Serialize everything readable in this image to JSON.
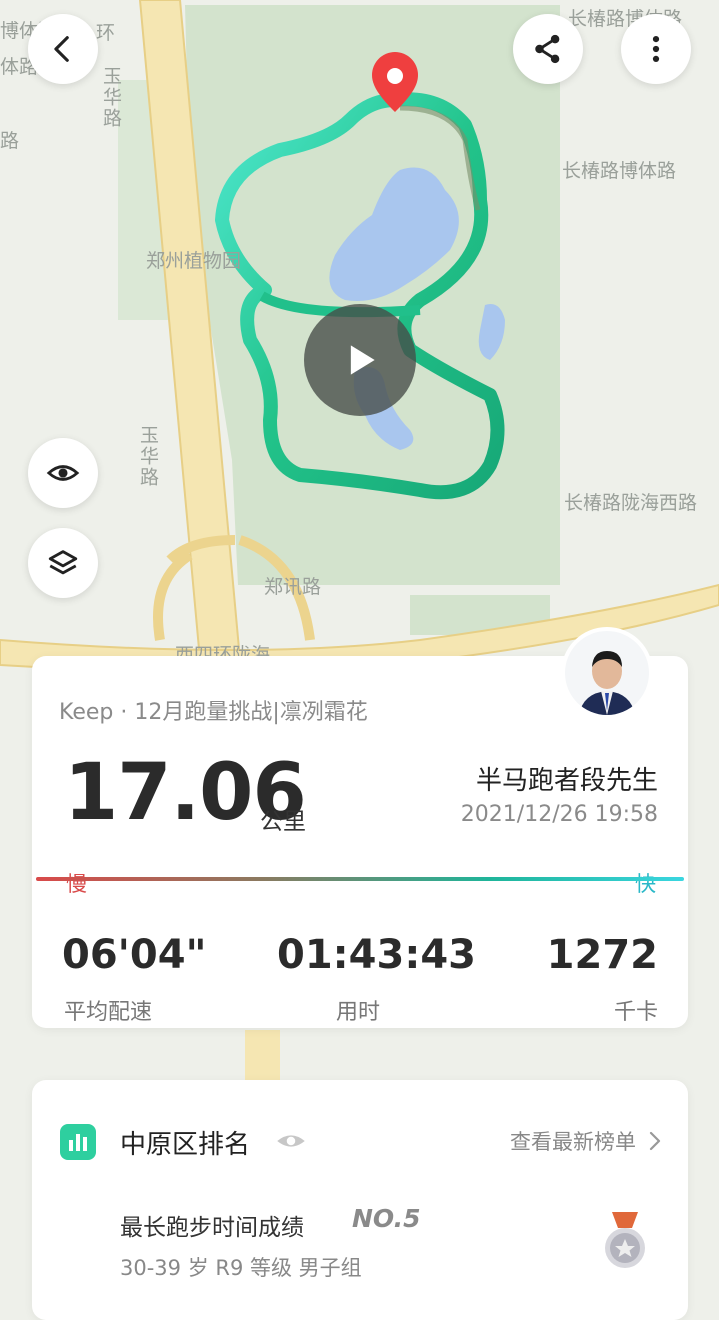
{
  "map": {
    "labels": {
      "top_left_1": "博体路",
      "top_left_2": "环",
      "left_1": "体路",
      "left_2": "路",
      "road_v1": "玉华路",
      "road_v2": "玉华路",
      "park": "郑州植物园",
      "right_top": "长椿路博体路",
      "right_mid": "长椿路博体路",
      "right_low": "长椿路陇海西路",
      "bottom_mid": "郑讯路",
      "bottom_left": "西四环陇海"
    },
    "route_color_start": "#2fe0b0",
    "route_color_end": "#1fb57a"
  },
  "stats": {
    "source": "Keep · 12月跑量挑战|凛冽霜花",
    "distance": "17.06",
    "distance_unit": "公里",
    "user_name": "半马跑者段先生",
    "datetime": "2021/12/26 19:58",
    "pace_slow": "慢",
    "pace_fast": "快",
    "avg_pace_value": "06'04\"",
    "avg_pace_label": "平均配速",
    "duration_value": "01:43:43",
    "duration_label": "用时",
    "calories_value": "1272",
    "calories_label": "千卡",
    "gradient_colors": [
      "#d94a4a",
      "#7a8a6a",
      "#1fb5a0",
      "#3ad6e0"
    ]
  },
  "rank": {
    "title": "中原区排名",
    "view_latest": "查看最新榜单",
    "item_title": "最长跑步时间成绩",
    "item_rank": "NO.5",
    "item_group": "30-39 岁 R9 等级 男子组",
    "accent": "#2ecf9f"
  }
}
